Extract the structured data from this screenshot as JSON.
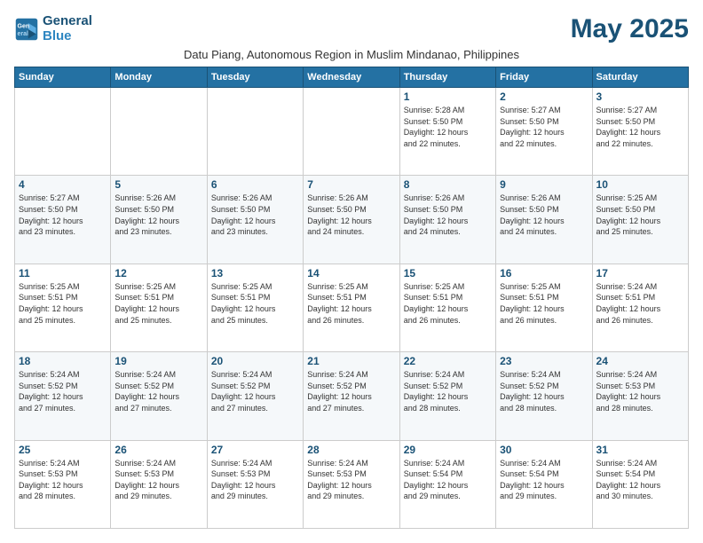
{
  "logo": {
    "line1": "General",
    "line2": "Blue"
  },
  "title": "May 2025",
  "location": "Datu Piang, Autonomous Region in Muslim Mindanao, Philippines",
  "days_of_week": [
    "Sunday",
    "Monday",
    "Tuesday",
    "Wednesday",
    "Thursday",
    "Friday",
    "Saturday"
  ],
  "weeks": [
    [
      {
        "day": "",
        "info": ""
      },
      {
        "day": "",
        "info": ""
      },
      {
        "day": "",
        "info": ""
      },
      {
        "day": "",
        "info": ""
      },
      {
        "day": "1",
        "info": "Sunrise: 5:28 AM\nSunset: 5:50 PM\nDaylight: 12 hours\nand 22 minutes."
      },
      {
        "day": "2",
        "info": "Sunrise: 5:27 AM\nSunset: 5:50 PM\nDaylight: 12 hours\nand 22 minutes."
      },
      {
        "day": "3",
        "info": "Sunrise: 5:27 AM\nSunset: 5:50 PM\nDaylight: 12 hours\nand 22 minutes."
      }
    ],
    [
      {
        "day": "4",
        "info": "Sunrise: 5:27 AM\nSunset: 5:50 PM\nDaylight: 12 hours\nand 23 minutes."
      },
      {
        "day": "5",
        "info": "Sunrise: 5:26 AM\nSunset: 5:50 PM\nDaylight: 12 hours\nand 23 minutes."
      },
      {
        "day": "6",
        "info": "Sunrise: 5:26 AM\nSunset: 5:50 PM\nDaylight: 12 hours\nand 23 minutes."
      },
      {
        "day": "7",
        "info": "Sunrise: 5:26 AM\nSunset: 5:50 PM\nDaylight: 12 hours\nand 24 minutes."
      },
      {
        "day": "8",
        "info": "Sunrise: 5:26 AM\nSunset: 5:50 PM\nDaylight: 12 hours\nand 24 minutes."
      },
      {
        "day": "9",
        "info": "Sunrise: 5:26 AM\nSunset: 5:50 PM\nDaylight: 12 hours\nand 24 minutes."
      },
      {
        "day": "10",
        "info": "Sunrise: 5:25 AM\nSunset: 5:50 PM\nDaylight: 12 hours\nand 25 minutes."
      }
    ],
    [
      {
        "day": "11",
        "info": "Sunrise: 5:25 AM\nSunset: 5:51 PM\nDaylight: 12 hours\nand 25 minutes."
      },
      {
        "day": "12",
        "info": "Sunrise: 5:25 AM\nSunset: 5:51 PM\nDaylight: 12 hours\nand 25 minutes."
      },
      {
        "day": "13",
        "info": "Sunrise: 5:25 AM\nSunset: 5:51 PM\nDaylight: 12 hours\nand 25 minutes."
      },
      {
        "day": "14",
        "info": "Sunrise: 5:25 AM\nSunset: 5:51 PM\nDaylight: 12 hours\nand 26 minutes."
      },
      {
        "day": "15",
        "info": "Sunrise: 5:25 AM\nSunset: 5:51 PM\nDaylight: 12 hours\nand 26 minutes."
      },
      {
        "day": "16",
        "info": "Sunrise: 5:25 AM\nSunset: 5:51 PM\nDaylight: 12 hours\nand 26 minutes."
      },
      {
        "day": "17",
        "info": "Sunrise: 5:24 AM\nSunset: 5:51 PM\nDaylight: 12 hours\nand 26 minutes."
      }
    ],
    [
      {
        "day": "18",
        "info": "Sunrise: 5:24 AM\nSunset: 5:52 PM\nDaylight: 12 hours\nand 27 minutes."
      },
      {
        "day": "19",
        "info": "Sunrise: 5:24 AM\nSunset: 5:52 PM\nDaylight: 12 hours\nand 27 minutes."
      },
      {
        "day": "20",
        "info": "Sunrise: 5:24 AM\nSunset: 5:52 PM\nDaylight: 12 hours\nand 27 minutes."
      },
      {
        "day": "21",
        "info": "Sunrise: 5:24 AM\nSunset: 5:52 PM\nDaylight: 12 hours\nand 27 minutes."
      },
      {
        "day": "22",
        "info": "Sunrise: 5:24 AM\nSunset: 5:52 PM\nDaylight: 12 hours\nand 28 minutes."
      },
      {
        "day": "23",
        "info": "Sunrise: 5:24 AM\nSunset: 5:52 PM\nDaylight: 12 hours\nand 28 minutes."
      },
      {
        "day": "24",
        "info": "Sunrise: 5:24 AM\nSunset: 5:53 PM\nDaylight: 12 hours\nand 28 minutes."
      }
    ],
    [
      {
        "day": "25",
        "info": "Sunrise: 5:24 AM\nSunset: 5:53 PM\nDaylight: 12 hours\nand 28 minutes."
      },
      {
        "day": "26",
        "info": "Sunrise: 5:24 AM\nSunset: 5:53 PM\nDaylight: 12 hours\nand 29 minutes."
      },
      {
        "day": "27",
        "info": "Sunrise: 5:24 AM\nSunset: 5:53 PM\nDaylight: 12 hours\nand 29 minutes."
      },
      {
        "day": "28",
        "info": "Sunrise: 5:24 AM\nSunset: 5:53 PM\nDaylight: 12 hours\nand 29 minutes."
      },
      {
        "day": "29",
        "info": "Sunrise: 5:24 AM\nSunset: 5:54 PM\nDaylight: 12 hours\nand 29 minutes."
      },
      {
        "day": "30",
        "info": "Sunrise: 5:24 AM\nSunset: 5:54 PM\nDaylight: 12 hours\nand 29 minutes."
      },
      {
        "day": "31",
        "info": "Sunrise: 5:24 AM\nSunset: 5:54 PM\nDaylight: 12 hours\nand 30 minutes."
      }
    ]
  ]
}
